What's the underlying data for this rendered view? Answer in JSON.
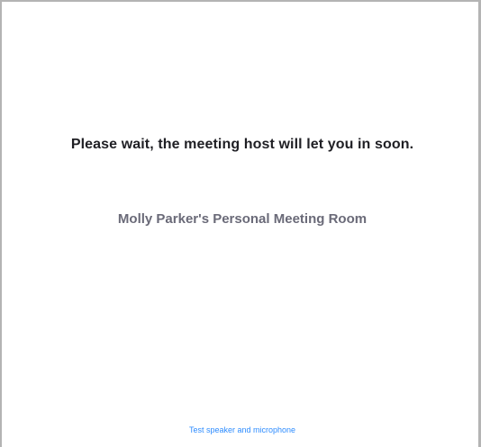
{
  "waiting_room": {
    "message": "Please wait, the meeting host will let you in soon.",
    "room_name": "Molly Parker's Personal Meeting Room",
    "test_audio_link": "Test speaker and microphone"
  },
  "colors": {
    "message": "#1f1f24",
    "room_name": "#6a6a78",
    "link": "#2d8cff",
    "border": "#b4b4b4"
  }
}
